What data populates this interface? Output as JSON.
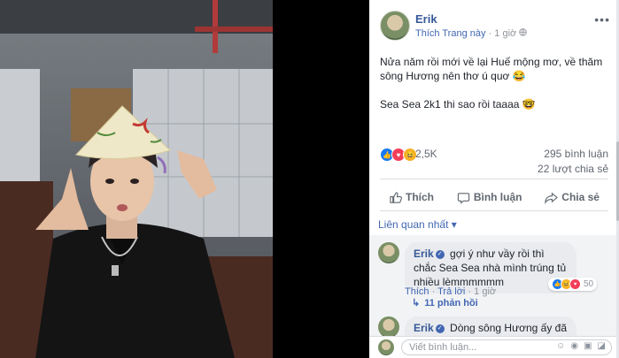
{
  "post": {
    "author": "Erik",
    "follow": "Thích Trang này",
    "dot": "·",
    "time": "1 giờ",
    "text_line1": "Nửa năm rồi mới về lại Huế mộng mơ, về thăm sông Hương nên thơ ú quơ 😂",
    "text_line2": "Sea Sea 2k1 thi sao rồi taaaa 🤓",
    "reaction_count": "2,5K",
    "comment_count": "295 bình luận",
    "share_count": "22 lượt chia sẻ"
  },
  "actions": {
    "like": "Thích",
    "comment": "Bình luận",
    "share": "Chia sẻ"
  },
  "sort_label": "Liên quan nhất",
  "comments": [
    {
      "name": "Erik",
      "text": "gợi ý như vầy rồi thì chắc Sea Sea nhà mình trúng tủ nhiều lèmmmmmm",
      "like_action": "Thích",
      "reply_action": "Trả lời",
      "time": "1 giờ",
      "reaction_count": "50"
    },
    {
      "name": "Erik",
      "text": "Dòng sông Hương ấy đã đưa các"
    }
  ],
  "replies_label": "11 phản hồi",
  "composer_placeholder": "Viết bình luận...",
  "icons": {
    "photo": "photo-pane",
    "more": "more-icon",
    "globe": "globe-icon",
    "like": "like-icon",
    "comment": "comment-icon",
    "share": "share-icon"
  },
  "colors": {
    "link": "#4267b2",
    "name": "#365899",
    "bubble": "#e9ebee"
  }
}
